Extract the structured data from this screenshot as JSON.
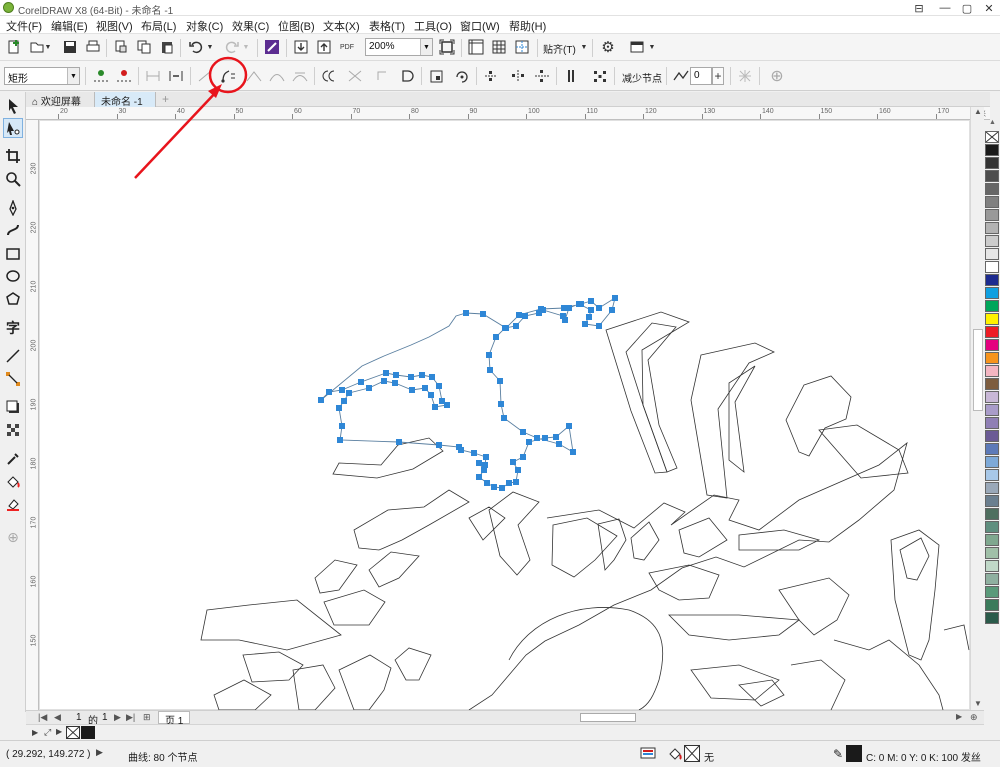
{
  "app": {
    "title": "CorelDRAW X8 (64-Bit) - 未命名 -1"
  },
  "window": {
    "min": "—",
    "max": "▢",
    "close": "✕",
    "extra": "⊟"
  },
  "menu": [
    {
      "label": "文件(F)"
    },
    {
      "label": "编辑(E)"
    },
    {
      "label": "视图(V)"
    },
    {
      "label": "布局(L)"
    },
    {
      "label": "对象(C)"
    },
    {
      "label": "效果(C)"
    },
    {
      "label": "位图(B)"
    },
    {
      "label": "文本(X)"
    },
    {
      "label": "表格(T)"
    },
    {
      "label": "工具(O)"
    },
    {
      "label": "窗口(W)"
    },
    {
      "label": "帮助(H)"
    }
  ],
  "toolbar": {
    "zoom": "200%",
    "snap_label": "贴齐(T)",
    "pdf_label": "PDF"
  },
  "property_bar": {
    "selection_mode": "矩形",
    "reduce_nodes": "减少节点",
    "smooth_value": "0"
  },
  "tabs": [
    {
      "label": "欢迎屏幕"
    },
    {
      "label": "未命名 -1"
    }
  ],
  "ruler": {
    "unit": "毫米",
    "h_ticks": [
      "20",
      "30",
      "40",
      "50",
      "60",
      "70",
      "80",
      "90",
      "100",
      "110",
      "120",
      "130",
      "140",
      "150",
      "160",
      "170"
    ],
    "v_ticks": [
      "230",
      "220",
      "210",
      "200",
      "190",
      "180",
      "170",
      "160",
      "150"
    ]
  },
  "page_nav": {
    "current": "1",
    "of": "的",
    "total": "1",
    "page_tab": "页 1"
  },
  "status": {
    "coords": "( 29.292, 149.272 )",
    "object_info": "曲线: 80 个节点",
    "fill_label": "无",
    "outline_info": "C: 0 M: 0 Y: 0 K: 100  发丝"
  },
  "colors": {
    "accent": "#3a8fd9",
    "node": "#2f87d6",
    "annotation_red": "#e8141c",
    "palette": [
      "#1a1a1a",
      "#333333",
      "#4d4d4d",
      "#666666",
      "#808080",
      "#999999",
      "#b3b3b3",
      "#cccccc",
      "#e6e6e6",
      "#ffffff",
      "#1d2b8f",
      "#0f9fe0",
      "#00a65a",
      "#fff200",
      "#ed1c24",
      "#e4007f",
      "#f7941d",
      "#f4b6c2",
      "#7d5c3e",
      "#c8b7d6",
      "#a99cc9",
      "#8f7fb5",
      "#6b5b95",
      "#5d7ab8",
      "#7da9d8",
      "#a8c8e8",
      "#9aa8b8",
      "#6b7f8f",
      "#4f6f5f",
      "#5f8f7f",
      "#7fa88f",
      "#a0c0a8",
      "#c0d8c8",
      "#8fb0a0",
      "#5a9a7a",
      "#3a7a5a",
      "#2a5a4a"
    ]
  }
}
